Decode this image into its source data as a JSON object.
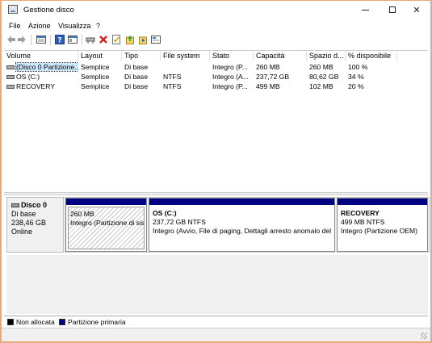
{
  "window": {
    "title": "Gestione disco"
  },
  "menu": [
    "File",
    "Azione",
    "Visualizza",
    "?"
  ],
  "table": {
    "columns": [
      "Volume",
      "Layout",
      "Tipo",
      "File system",
      "Stato",
      "Capacità",
      "Spazio d...",
      "% disponibile"
    ],
    "rows": [
      [
        "(Disco 0 Partizione...",
        "Semplice",
        "Di base",
        "",
        "Integro (P...",
        "260 MB",
        "260 MB",
        "100 %"
      ],
      [
        "OS (C:)",
        "Semplice",
        "Di base",
        "NTFS",
        "Integro (A...",
        "237,72 GB",
        "80,62 GB",
        "34 %"
      ],
      [
        "RECOVERY",
        "Semplice",
        "Di base",
        "NTFS",
        "Integro (P...",
        "499 MB",
        "102 MB",
        "20 %"
      ]
    ]
  },
  "disk": {
    "name": "Disco 0",
    "type": "Di base",
    "size": "238,46 GB",
    "status": "Online",
    "partitions": [
      {
        "title": "",
        "size": "260 MB",
        "status": "Integro (Partizione di sistema EFI)"
      },
      {
        "title": "OS  (C:)",
        "size": "237,72 GB NTFS",
        "status": "Integro (Avvio, File di paging, Dettagli arresto anomalo del sistema, Partizione primaria)"
      },
      {
        "title": "RECOVERY",
        "size": "499 MB NTFS",
        "status": "Integro (Partizione OEM)"
      }
    ]
  },
  "legend": [
    {
      "label": "Non allocata",
      "color": "#000000"
    },
    {
      "label": "Partizione primaria",
      "color": "#000080"
    }
  ],
  "toolbar_icons": [
    "back-arrow-icon",
    "forward-arrow-icon",
    "list-view-icon",
    "help-icon",
    "properties-icon",
    "connect-icon",
    "delete-icon",
    "check-icon",
    "import-icon",
    "export-icon",
    "rescan-icon"
  ]
}
